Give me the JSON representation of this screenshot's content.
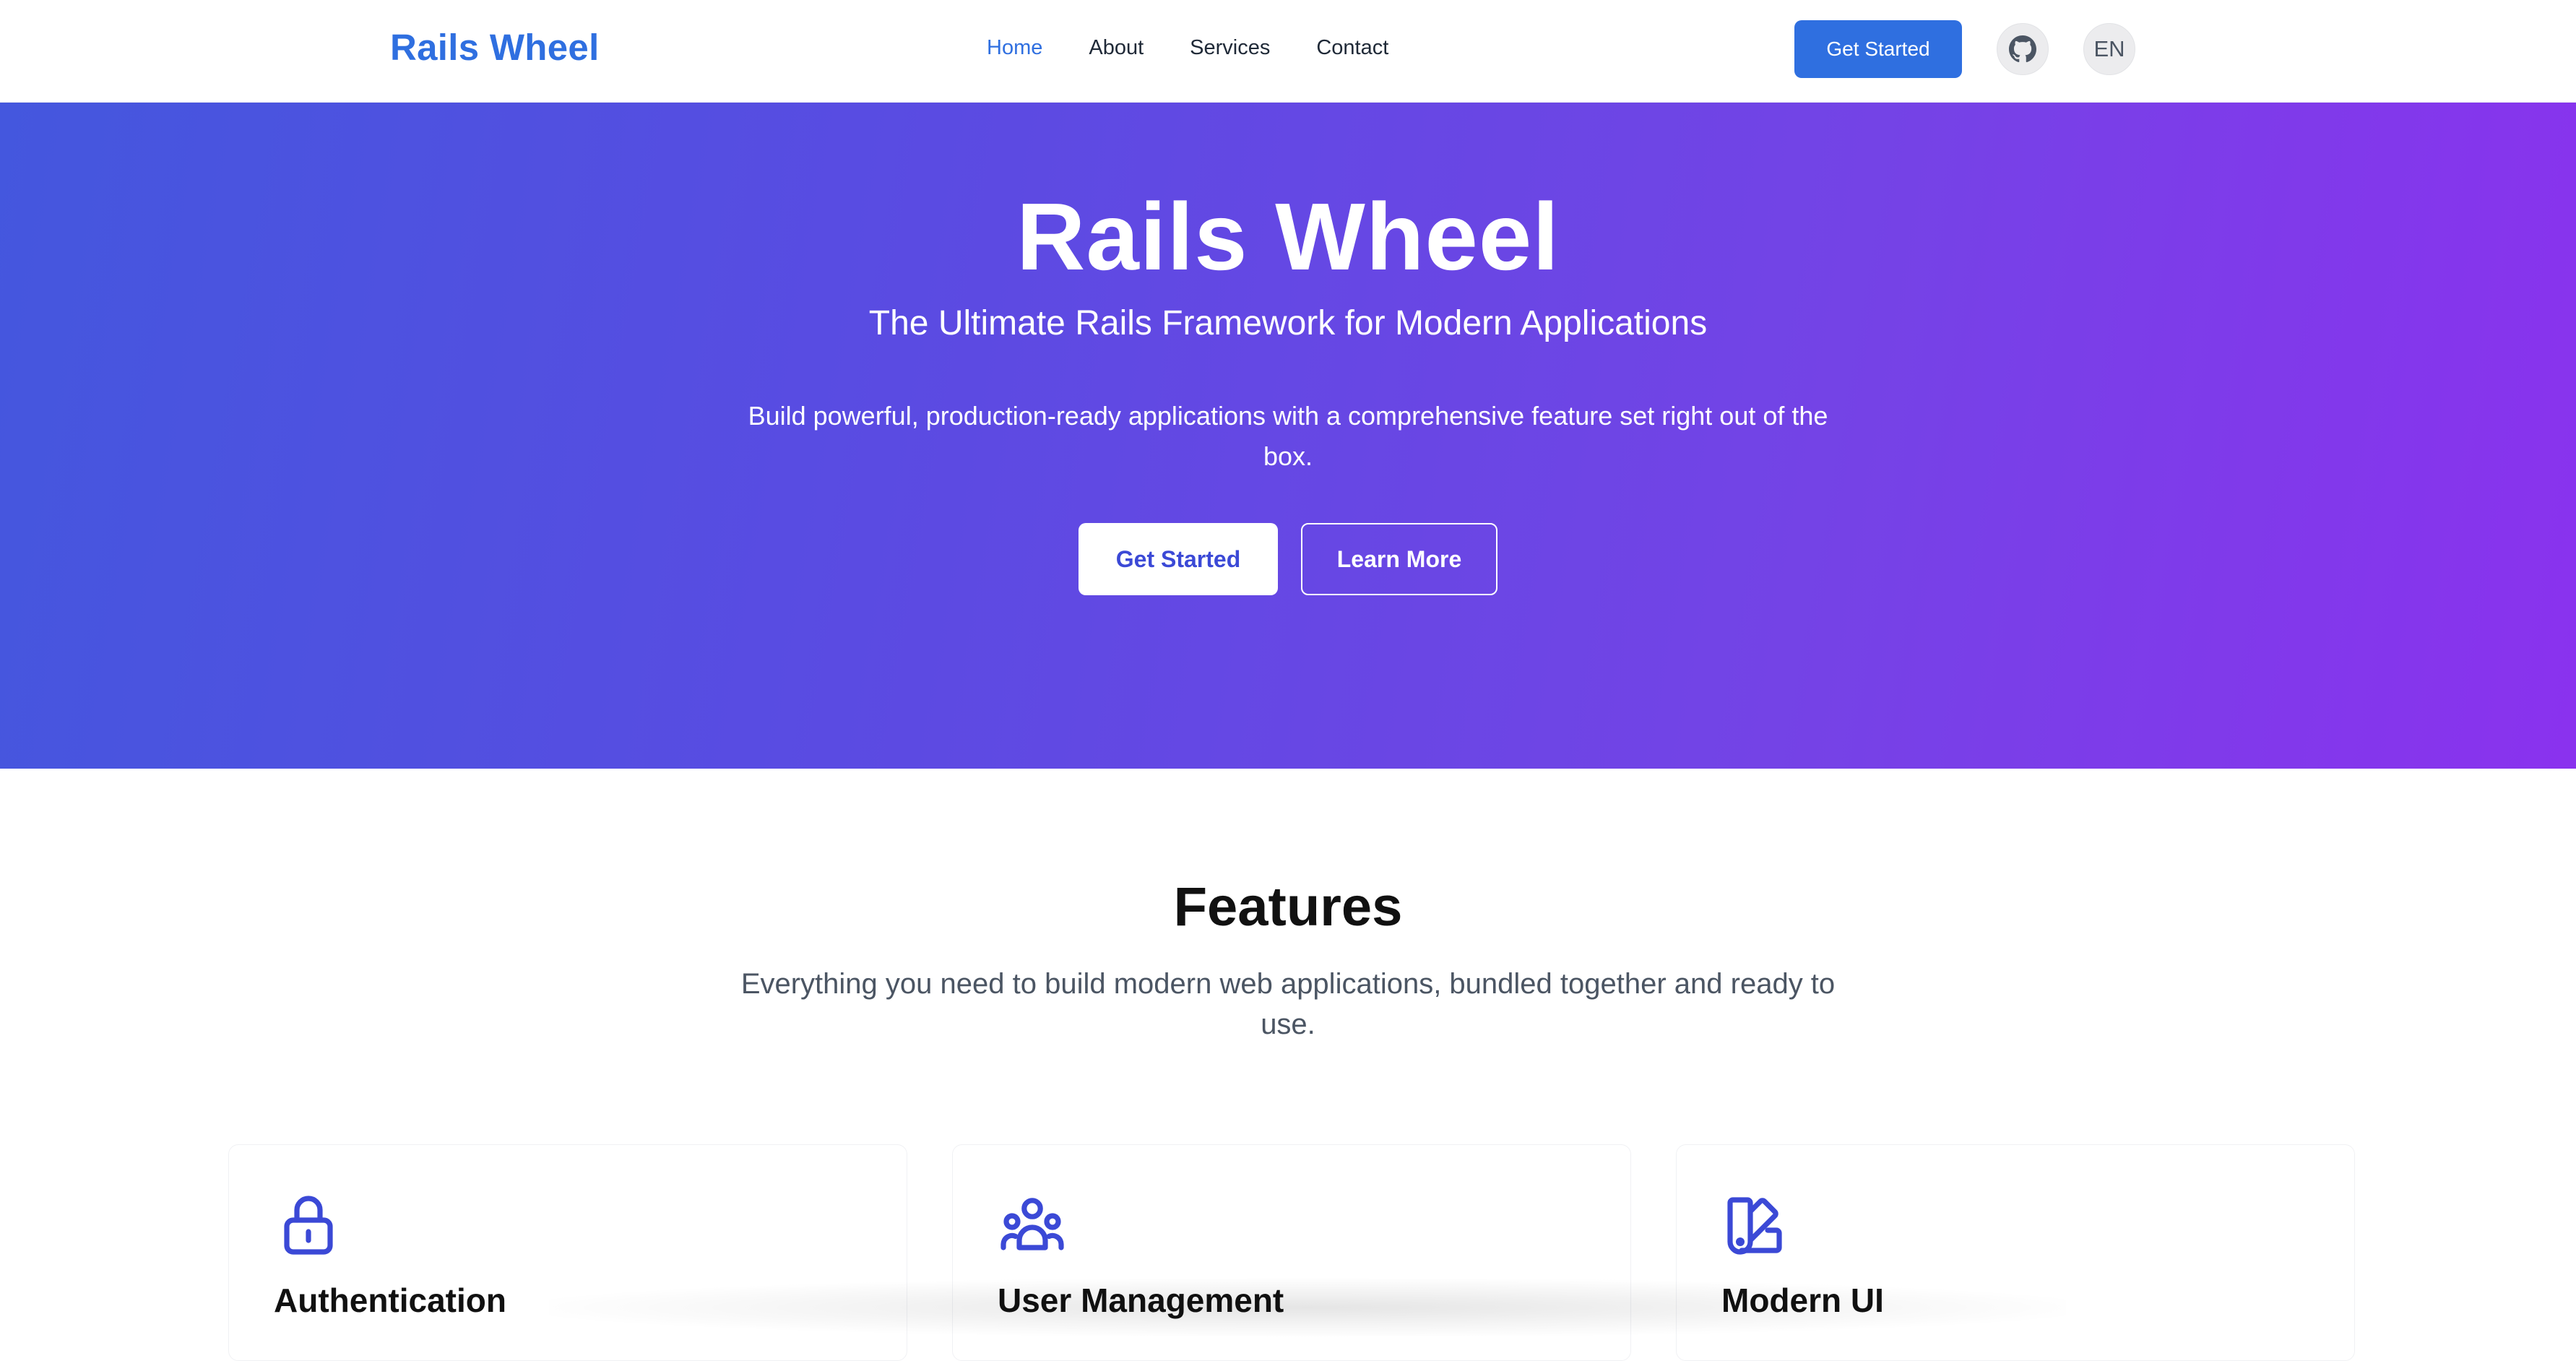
{
  "header": {
    "logo": "Rails Wheel",
    "nav": [
      {
        "label": "Home",
        "active": true
      },
      {
        "label": "About",
        "active": false
      },
      {
        "label": "Services",
        "active": false
      },
      {
        "label": "Contact",
        "active": false
      }
    ],
    "cta_label": "Get Started",
    "github_icon": "github-icon",
    "language": "EN"
  },
  "hero": {
    "title": "Rails Wheel",
    "subtitle": "The Ultimate Rails Framework for Modern Applications",
    "description": "Build powerful, production-ready applications with a comprehensive feature set right out of the box.",
    "primary_button": "Get Started",
    "secondary_button": "Learn More"
  },
  "features": {
    "title": "Features",
    "subtitle": "Everything you need to build modern web applications, bundled together and ready to use.",
    "cards": [
      {
        "icon": "lock-icon",
        "title": "Authentication"
      },
      {
        "icon": "users-icon",
        "title": "User Management"
      },
      {
        "icon": "palette-icon",
        "title": "Modern UI"
      }
    ]
  },
  "colors": {
    "brand": "#2f6fe0",
    "hero_gradient_start": "#4457de",
    "hero_gradient_end": "#8a32ee",
    "feature_icon": "#3b49d6"
  }
}
